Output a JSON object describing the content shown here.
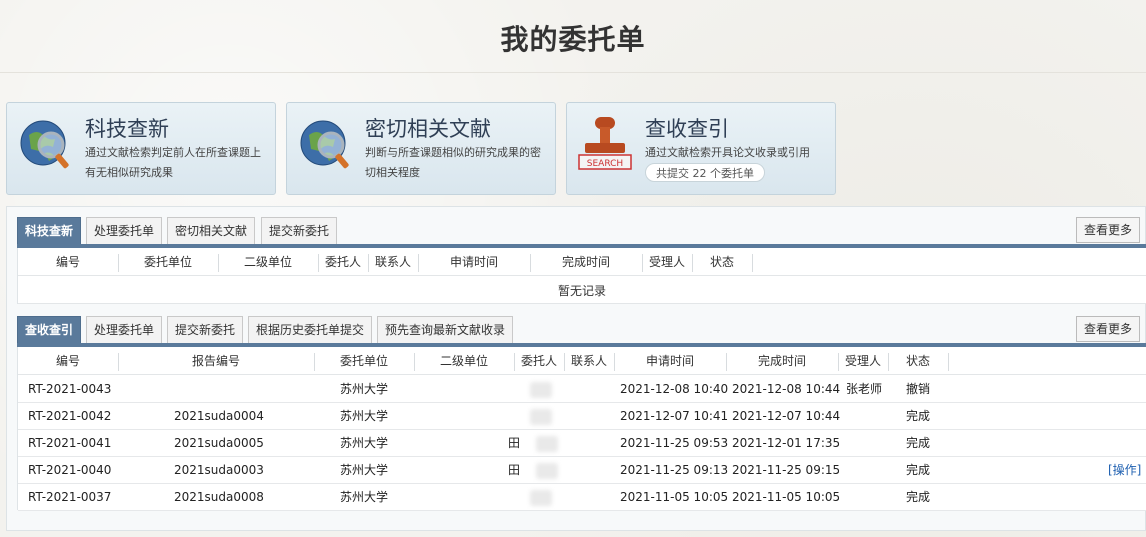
{
  "page": {
    "title": "我的委托单"
  },
  "cards": [
    {
      "title": "科技查新",
      "desc": "通过文献检索判定前人在所查课题上有无相似研究成果",
      "icon": "globe-magnifier-icon"
    },
    {
      "title": "密切相关文献",
      "desc": "判断与所查课题相似的研究成果的密切相关程度",
      "icon": "globe-magnifier-icon"
    },
    {
      "title": "查收查引",
      "desc": "通过文献检索开具论文收录或引用",
      "badge": "共提交 22 个委托单",
      "icon": "search-stamp-icon"
    }
  ],
  "section1": {
    "tabs": [
      "科技查新",
      "处理委托单",
      "密切相关文献",
      "提交新委托"
    ],
    "more": "查看更多",
    "headers": [
      "编号",
      "委托单位",
      "二级单位",
      "委托人",
      "联系人",
      "申请时间",
      "完成时间",
      "受理人",
      "状态"
    ],
    "empty": "暂无记录"
  },
  "section2": {
    "tabs": [
      "查收查引",
      "处理委托单",
      "提交新委托",
      "根据历史委托单提交",
      "预先查询最新文献收录"
    ],
    "more": "查看更多",
    "headers": [
      "编号",
      "报告编号",
      "委托单位",
      "二级单位",
      "委托人",
      "联系人",
      "申请时间",
      "完成时间",
      "受理人",
      "状态"
    ],
    "rows": [
      {
        "id": "RT-2021-0043",
        "report": "",
        "unit": "苏州大学",
        "applicant": "",
        "applied": "2021-12-08 10:40",
        "done": "2021-12-08 10:44",
        "handler": "张老师",
        "status": "撤销",
        "op": ""
      },
      {
        "id": "RT-2021-0042",
        "report": "2021suda0004",
        "unit": "苏州大学",
        "applicant": "",
        "applied": "2021-12-07 10:41",
        "done": "2021-12-07 10:44",
        "handler": "",
        "status": "完成",
        "op": ""
      },
      {
        "id": "RT-2021-0041",
        "report": "2021suda0005",
        "unit": "苏州大学",
        "applicant": "田",
        "applied": "2021-11-25 09:53",
        "done": "2021-12-01 17:35",
        "handler": "",
        "status": "完成",
        "op": ""
      },
      {
        "id": "RT-2021-0040",
        "report": "2021suda0003",
        "unit": "苏州大学",
        "applicant": "田",
        "applied": "2021-11-25 09:13",
        "done": "2021-11-25 09:15",
        "handler": "",
        "status": "完成",
        "op": "[操作]"
      },
      {
        "id": "RT-2021-0037",
        "report": "2021suda0008",
        "unit": "苏州大学",
        "applicant": "",
        "applied": "2021-11-05 10:05",
        "done": "2021-11-05 10:05",
        "handler": "",
        "status": "完成",
        "op": ""
      }
    ]
  }
}
